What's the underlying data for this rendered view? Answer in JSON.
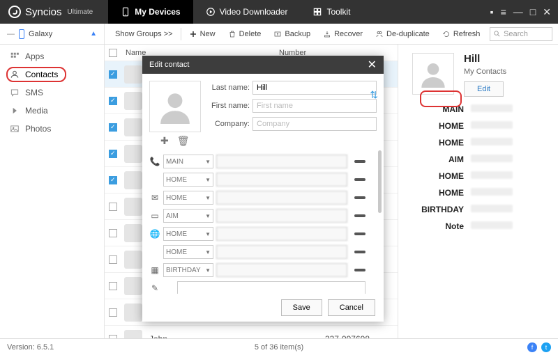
{
  "header": {
    "brand": "Syncios",
    "edition": "Ultimate",
    "tabs": [
      {
        "label": "My Devices"
      },
      {
        "label": "Video Downloader"
      },
      {
        "label": "Toolkit"
      }
    ]
  },
  "device": {
    "name": "Galaxy"
  },
  "toolbar": {
    "groups": "Show Groups  >>",
    "new": "New",
    "delete": "Delete",
    "backup": "Backup",
    "recover": "Recover",
    "dedup": "De-duplicate",
    "refresh": "Refresh",
    "search_ph": "Search"
  },
  "sidebar": {
    "items": [
      {
        "label": "Apps"
      },
      {
        "label": "Contacts"
      },
      {
        "label": "SMS"
      },
      {
        "label": "Media"
      },
      {
        "label": "Photos"
      }
    ]
  },
  "columns": {
    "name": "Name",
    "number": "Number"
  },
  "rows": [
    {
      "checked": true,
      "sel": true
    },
    {
      "checked": true
    },
    {
      "checked": true
    },
    {
      "checked": true
    },
    {
      "checked": true
    },
    {
      "checked": false
    },
    {
      "checked": false
    },
    {
      "checked": false
    },
    {
      "checked": false
    },
    {
      "checked": false
    },
    {
      "name": "John",
      "number": "337-997698"
    }
  ],
  "detail": {
    "name": "Hill",
    "group": "My Contacts",
    "edit": "Edit",
    "fields": [
      "MAIN",
      "HOME",
      "HOME",
      "AIM",
      "HOME",
      "HOME",
      "BIRTHDAY",
      "Note"
    ]
  },
  "modal": {
    "title": "Edit contact",
    "last_lbl": "Last name:",
    "first_lbl": "First name:",
    "company_lbl": "Company:",
    "last_val": "Hill",
    "first_ph": "First name",
    "company_ph": "Company",
    "rows": [
      {
        "icon": "phone",
        "type": "MAIN"
      },
      {
        "icon": "",
        "type": "HOME"
      },
      {
        "icon": "mail",
        "type": "HOME"
      },
      {
        "icon": "chat",
        "type": "AIM"
      },
      {
        "icon": "globe",
        "type": "HOME"
      },
      {
        "icon": "",
        "type": "HOME"
      },
      {
        "icon": "calendar",
        "type": "BIRTHDAY"
      },
      {
        "icon": "note",
        "type": ""
      }
    ],
    "save": "Save",
    "cancel": "Cancel"
  },
  "footer": {
    "version": "Version: 6.5.1",
    "count": "5 of 36 item(s)"
  }
}
